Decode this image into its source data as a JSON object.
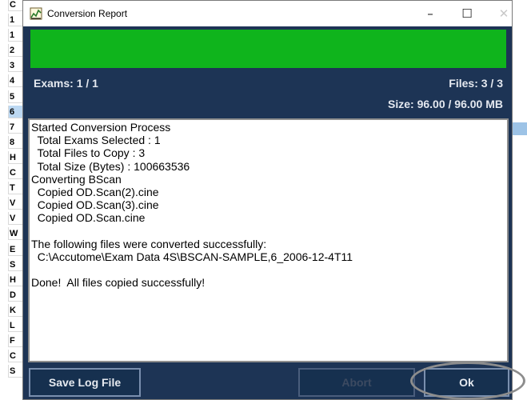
{
  "background_sheet": {
    "row_letters": [
      "C",
      "1",
      "1",
      "2",
      "3",
      "4",
      "5",
      "6",
      "7",
      "8",
      "H",
      "C",
      "T",
      "V",
      "V",
      "W",
      "E",
      "S",
      "H",
      "D",
      "K",
      "L",
      "F",
      "C",
      "S"
    ],
    "selected_index": 7
  },
  "window": {
    "title": "Conversion Report",
    "app_icon": "chart-icon",
    "minimize_glyph": "–",
    "maximize_glyph": "☐",
    "close_glyph": "✕"
  },
  "progress": {
    "fraction": 1.0,
    "color": "#0fb41c"
  },
  "stats": {
    "exams": "Exams: 1 / 1",
    "files": "Files: 3 / 3",
    "size": "Size: 96.00 / 96.00 MB"
  },
  "log": {
    "lines": [
      "Started Conversion Process",
      "  Total Exams Selected : 1",
      "  Total Files to Copy : 3",
      "  Total Size (Bytes) : 100663536",
      "Converting BScan",
      "  Copied OD.Scan(2).cine",
      "  Copied OD.Scan(3).cine",
      "  Copied OD.Scan.cine",
      "",
      "The following files were converted successfully:",
      "  C:\\Accutome\\Exam Data 4S\\BSCAN-SAMPLE,6_2006-12-4T11",
      "",
      "Done!  All files copied successfully!"
    ]
  },
  "buttons": {
    "save_log": "Save Log File",
    "abort": "Abort",
    "ok": "Ok"
  },
  "colors": {
    "dialog_bg": "#1d3455",
    "button_bg": "#16304f",
    "highlight_ring": "#8d8d8d"
  }
}
